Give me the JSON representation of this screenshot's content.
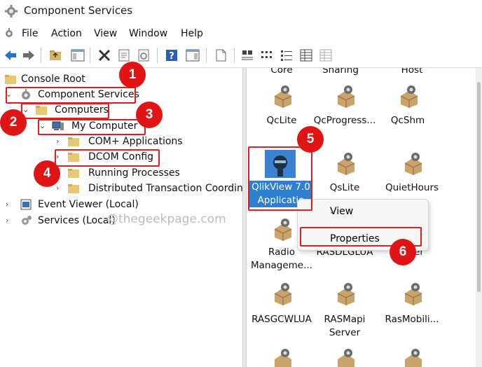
{
  "window": {
    "title": "Component Services"
  },
  "menu": [
    "File",
    "Action",
    "View",
    "Window",
    "Help"
  ],
  "tree": {
    "root": "Console Root",
    "component_services": "Component Services",
    "computers": "Computers",
    "my_computer": "My Computer",
    "com_apps": "COM+ Applications",
    "dcom_config": "DCOM Config",
    "running_processes": "Running Processes",
    "dtc": "Distributed Transaction Coordinator",
    "event_viewer": "Event Viewer (Local)",
    "services": "Services (Local)"
  },
  "watermark": "@thegeekpage.com",
  "items": {
    "top_partial": [
      "Core",
      "Sharing",
      "Host"
    ],
    "row1": [
      "QcLite",
      "QcProgress...",
      "QcShm"
    ],
    "qlikview": [
      "QlikView 7.0",
      "Applicatio"
    ],
    "row2": [
      "QsLite",
      "QuietHours"
    ],
    "radio": [
      "Radio",
      "Manageme..."
    ],
    "rasdlg": "RASDLGLUA",
    "partial_ver": "ver",
    "row4": [
      "RASGCWLUA",
      "RASMapi",
      "Server",
      "RasMobili..."
    ]
  },
  "context_menu": {
    "view": "View",
    "properties": "Properties"
  },
  "badges": [
    "1",
    "2",
    "3",
    "4",
    "5",
    "6"
  ],
  "colors": {
    "highlight": "#e02020",
    "selection": "#2f7fd0"
  }
}
